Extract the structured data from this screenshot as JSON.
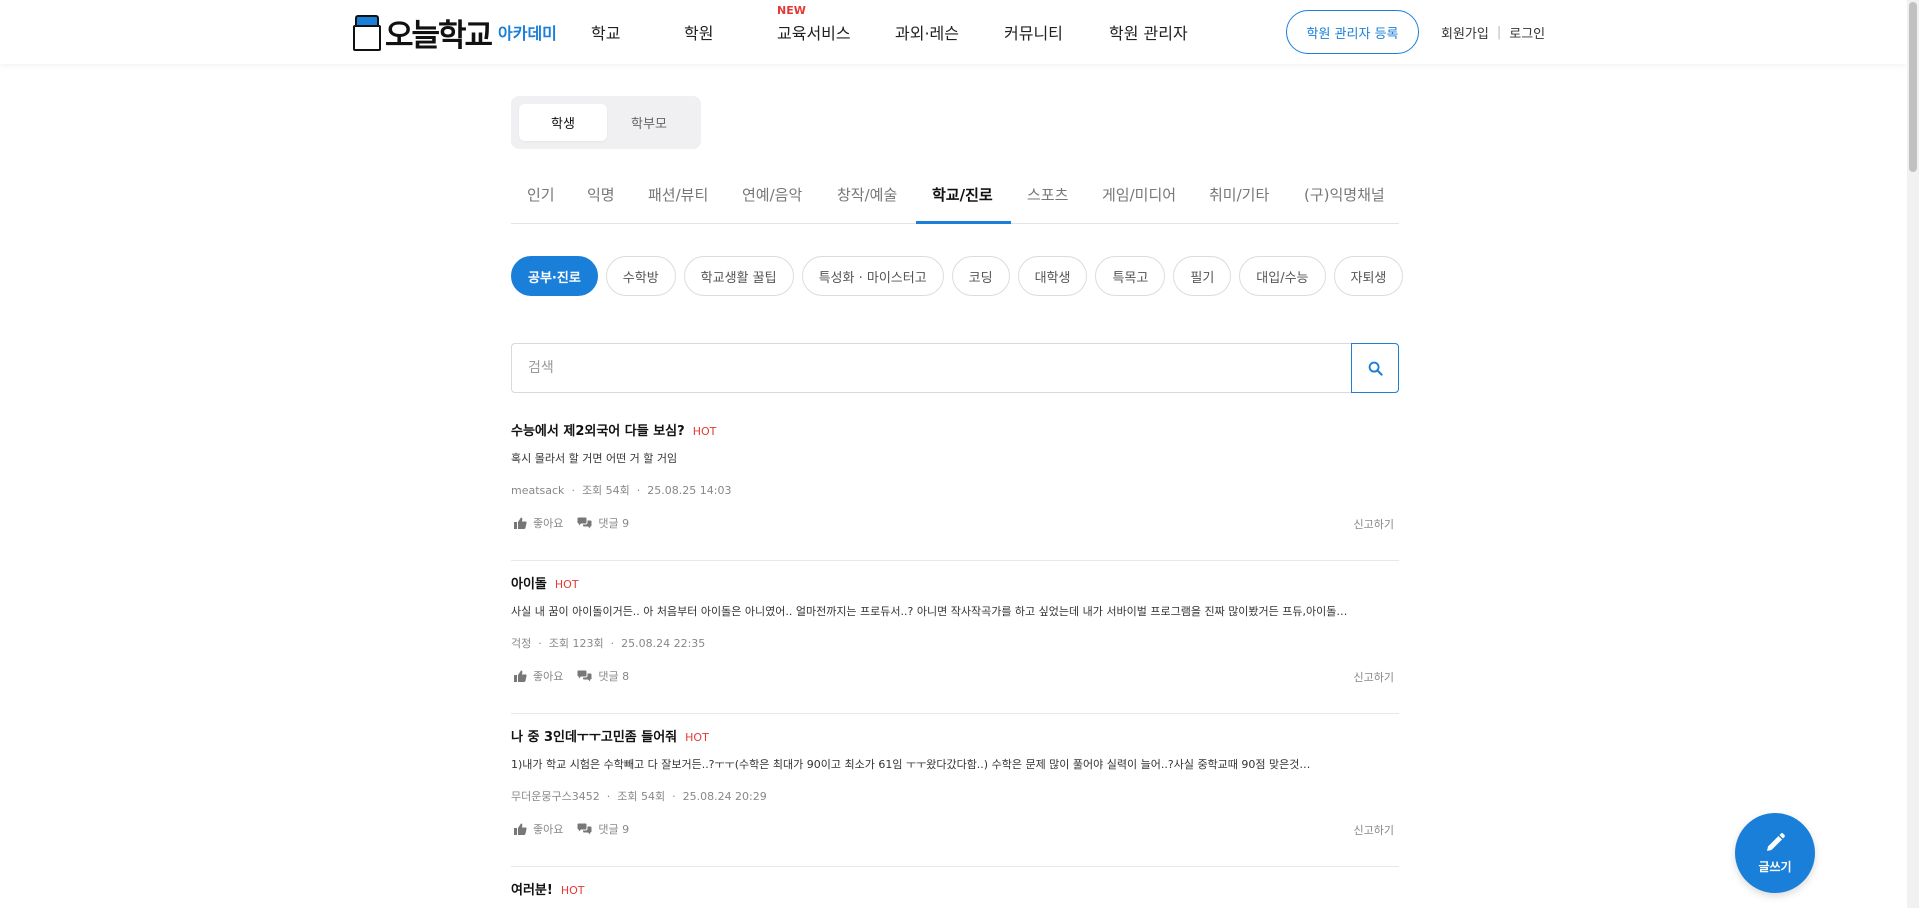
{
  "header": {
    "logo_text": "오늘학교",
    "academy_label": "아카데미",
    "nav": [
      "학교",
      "학원",
      "교육서비스",
      "과외·레슨",
      "커뮤니티",
      "학원 관리자"
    ],
    "new_badge": "NEW",
    "register_button": "학원 관리자 등록",
    "signup": "회원가입",
    "separator": "|",
    "login": "로그인"
  },
  "role_toggle": [
    "학생",
    "학부모"
  ],
  "tabs": [
    "인기",
    "익명",
    "패션/뷰티",
    "연예/음악",
    "창작/예술",
    "학교/진로",
    "스포츠",
    "게임/미디어",
    "취미/기타",
    "(구)익명채널"
  ],
  "active_tab": "학교/진로",
  "chips": [
    "공부·진로",
    "수학방",
    "학교생활 꿀팁",
    "특성화 · 마이스터고",
    "코딩",
    "대학생",
    "특목고",
    "필기",
    "대입/수능",
    "자퇴생"
  ],
  "active_chip": "공부·진로",
  "search": {
    "placeholder": "검색"
  },
  "posts": [
    {
      "title": "수능에서 제2외국어 다들 보심?",
      "badge": "HOT",
      "body": "혹시 몰라서 할 거면 어떤 거 할 거임",
      "author": "meatsack",
      "views": "조회 54회",
      "date": "25.08.25 14:03",
      "like_label": "좋아요",
      "comment_label": "댓글 9",
      "report_label": "신고하기"
    },
    {
      "title": "아이돌",
      "badge": "HOT",
      "body": "사실 내 꿈이 아이돌이거든.. 아 처음부터 아이돌은 아니였어.. 얼마전까지는 프로듀서..? 아니면 작사작곡가를 하고 싶었는데 내가 서바이벌 프로그램을 진짜 많이봤거든 프듀,아이돌…",
      "author": "걱정",
      "views": "조회 123회",
      "date": "25.08.24 22:35",
      "like_label": "좋아요",
      "comment_label": "댓글 8",
      "report_label": "신고하기"
    },
    {
      "title": "나 중 3인데ㅜㅜ고민좀 들어줘",
      "badge": "HOT",
      "body": "1)내가 학교 시험은 수학빼고 다 잘보거든..?ㅜㅜ(수학은 최대가 90이고 최소가 61임 ㅜㅜ왔다갔다함..) 수학은 문제 많이 풀어야 실력이 늘어..?사실 중학교때 90점 맞은것…",
      "author": "무더운뭉구스3452",
      "views": "조회 54회",
      "date": "25.08.24 20:29",
      "like_label": "좋아요",
      "comment_label": "댓글 9",
      "report_label": "신고하기"
    },
    {
      "title": "여러분!",
      "badge": "HOT"
    }
  ],
  "fab_label": "글쓰기",
  "colors": {
    "accent": "#1a7fd9",
    "hot": "#e53935",
    "new": "#e53935"
  },
  "icons": [
    "search-icon",
    "thumbs-up-icon",
    "comments-icon",
    "pencil-icon"
  ]
}
